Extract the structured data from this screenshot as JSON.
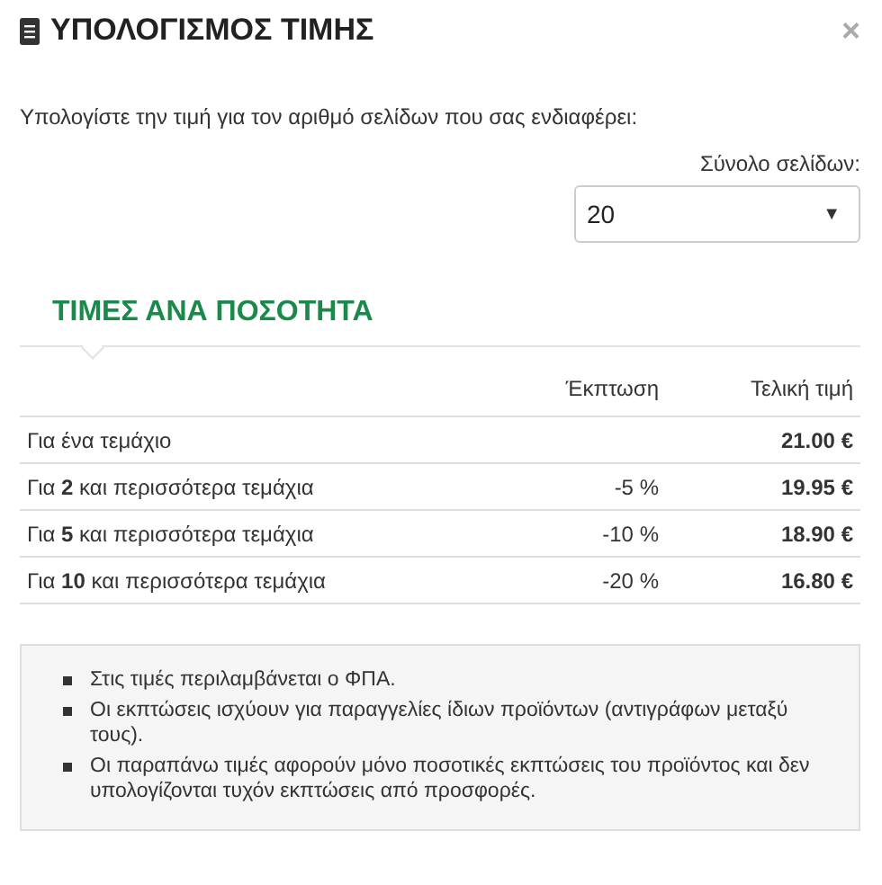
{
  "dialog": {
    "title": "ΥΠΟΛΟΓΙΣΜΟΣ ΤΙΜΗΣ",
    "close": "×"
  },
  "intro": "Υπολογίστε την τιμή για τον αριθμό σελίδων που σας ενδιαφέρει:",
  "pages_select": {
    "label": "Σύνολο σελίδων:",
    "value": "20",
    "caret": "▼"
  },
  "section_title": "ΤΙΜΕΣ ΑΝΑ ΠΟΣΟΤΗΤΑ",
  "table": {
    "columns": [
      "Έκπτωση",
      "Τελική τιμή"
    ],
    "rows": [
      {
        "quantity": "Για ένα τεμάχιο",
        "price": "21.00 €"
      },
      {
        "quantity": "Για **2** και περισσότερα τεμάχια",
        "discount": "-5 %",
        "price": "19.95 €"
      },
      {
        "quantity": "Για **5** και περισσότερα τεμάχια",
        "discount": "-10 %",
        "price": "18.90 €"
      },
      {
        "quantity": "Για **10** και περισσότερα τεμάχια",
        "discount": "-20 %",
        "price": "16.80 €"
      }
    ]
  },
  "notes": [
    "Στις τιμές περιλαμβάνεται ο ΦΠΑ.",
    "Οι εκπτώσεις ισχύουν για παραγγελίες ίδιων προϊόντων (αντιγράφων μεταξύ τους).",
    "Οι παραπάνω τιμές αφορούν μόνο ποσοτικές εκπτώσεις του προϊόντος και δεν υπολογίζονται τυχόν εκπτώσεις από προσφορές."
  ]
}
